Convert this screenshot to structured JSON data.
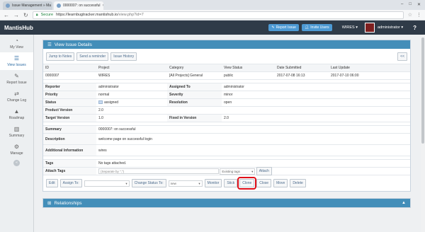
{
  "browser": {
    "tabs": [
      {
        "title": "Issue Management » Ma"
      },
      {
        "title": "0000007: on successful"
      }
    ],
    "secure_label": "Secure",
    "url_host": "https://learnbugtracker.mantishub.io",
    "url_path": "/view.php?id=7"
  },
  "navbar": {
    "brand": "MantisHub",
    "report_issue": "Report Issue",
    "invite_users": "Invite Users",
    "project": "WIRES",
    "user": "administrator",
    "help": "?"
  },
  "sidebar": {
    "items": [
      {
        "label": "My View",
        "icon": "dashboard-icon"
      },
      {
        "label": "View Issues",
        "icon": "list-icon"
      },
      {
        "label": "Report Issue",
        "icon": "edit-icon"
      },
      {
        "label": "Change Log",
        "icon": "retweet-icon"
      },
      {
        "label": "Roadmap",
        "icon": "road-icon"
      },
      {
        "label": "Summary",
        "icon": "bar-chart-icon"
      },
      {
        "label": "Manage",
        "icon": "gears-icon"
      }
    ]
  },
  "panel": {
    "title": "View Issue Details",
    "buttons": [
      "Jump to Notes",
      "Send a reminder",
      "Issue History"
    ],
    "collapse_btn": "<<",
    "headers": [
      "ID",
      "Project",
      "Category",
      "View Status",
      "Date Submitted",
      "Last Update"
    ],
    "row": [
      "0000007",
      "WIRES",
      "[All Projects] General",
      "public",
      "2017-07-08 16:13",
      "2017-07-10 06:00"
    ],
    "fields": {
      "reporter_label": "Reporter",
      "reporter": "administrator",
      "assigned_label": "Assigned To",
      "assigned": "administrator",
      "priority_label": "Priority",
      "priority": "normal",
      "severity_label": "Severity",
      "severity": "minor",
      "status_label": "Status",
      "status": "assigned",
      "resolution_label": "Resolution",
      "resolution": "open",
      "product_version_label": "Product Version",
      "product_version": "2.0",
      "target_version_label": "Target Version",
      "target_version": "1.0",
      "fixed_version_label": "Fixed in Version",
      "fixed_version": "2.0",
      "summary_label": "Summary",
      "summary": "0000007: on successful",
      "description_label": "Description",
      "description": "welcome page on successful login",
      "additional_label": "Additional Information",
      "additional": "wires",
      "tags_label": "Tags",
      "tags": "No tags attached.",
      "attach_tags_label": "Attach Tags",
      "attach_tags_placeholder": "(Separate by \",\")",
      "existing_tags": "Existing tags",
      "attach_btn": "Attach"
    },
    "actions": {
      "edit": "Edit",
      "assign_to": "Assign To:",
      "assign_select": "",
      "change_status": "Change Status To:",
      "status_select": "new",
      "monitor": "Monitor",
      "stick": "Stick",
      "clone": "Clone",
      "close": "Close",
      "move": "Move",
      "delete": "Delete"
    }
  },
  "relationships": {
    "title": "Relationships"
  },
  "colors": {
    "accent": "#438eb9",
    "navbar": "#2f3b48",
    "highlight": "#e0101a"
  }
}
